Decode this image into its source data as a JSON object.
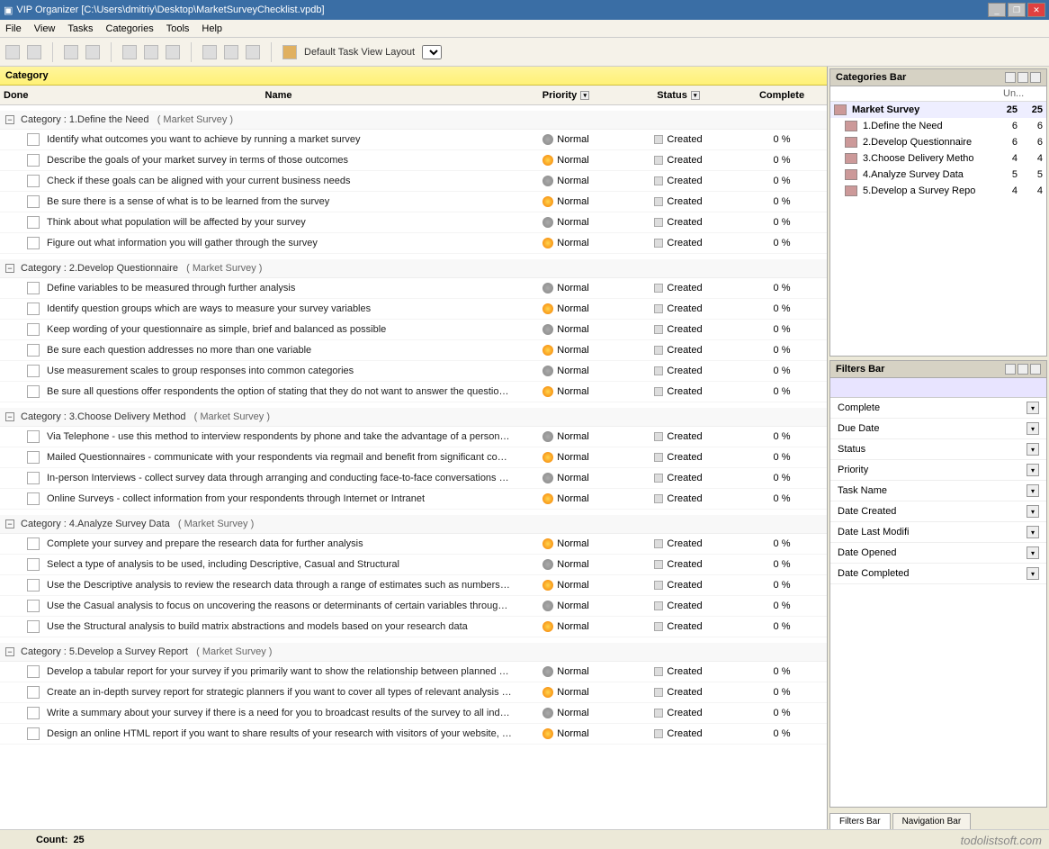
{
  "window": {
    "title": "VIP Organizer [C:\\Users\\dmitriy\\Desktop\\MarketSurveyChecklist.vpdb]"
  },
  "menu": [
    "File",
    "View",
    "Tasks",
    "Categories",
    "Tools",
    "Help"
  ],
  "toolbar": {
    "layoutLabel": "Default Task View Layout"
  },
  "groupHeader": "Category",
  "columns": {
    "done": "Done",
    "name": "Name",
    "priority": "Priority",
    "status": "Status",
    "complete": "Complete"
  },
  "groups": [
    {
      "name": "1.Define the Need",
      "parent": "Market Survey",
      "tasks": [
        {
          "name": "Identify what outcomes you want to achieve by running a market survey",
          "prio": "Normal",
          "pi": "a",
          "status": "Created",
          "comp": "0 %"
        },
        {
          "name": "Describe the goals of your market survey in terms of those outcomes",
          "prio": "Normal",
          "pi": "b",
          "status": "Created",
          "comp": "0 %"
        },
        {
          "name": "Check if these goals can be aligned with your current business needs",
          "prio": "Normal",
          "pi": "a",
          "status": "Created",
          "comp": "0 %"
        },
        {
          "name": "Be sure there is a sense of what is to be learned from the survey",
          "prio": "Normal",
          "pi": "b",
          "status": "Created",
          "comp": "0 %"
        },
        {
          "name": "Think about what population will be affected by your survey",
          "prio": "Normal",
          "pi": "a",
          "status": "Created",
          "comp": "0 %"
        },
        {
          "name": "Figure out what information you will gather through the survey",
          "prio": "Normal",
          "pi": "b",
          "status": "Created",
          "comp": "0 %"
        }
      ]
    },
    {
      "name": "2.Develop Questionnaire",
      "parent": "Market Survey",
      "tasks": [
        {
          "name": "Define variables to be measured through further analysis",
          "prio": "Normal",
          "pi": "a",
          "status": "Created",
          "comp": "0 %"
        },
        {
          "name": "Identify question groups which are ways to measure your survey variables",
          "prio": "Normal",
          "pi": "b",
          "status": "Created",
          "comp": "0 %"
        },
        {
          "name": "Keep wording of your questionnaire as simple, brief and balanced as possible",
          "prio": "Normal",
          "pi": "a",
          "status": "Created",
          "comp": "0 %"
        },
        {
          "name": "Be sure each question addresses no more than one variable",
          "prio": "Normal",
          "pi": "b",
          "status": "Created",
          "comp": "0 %"
        },
        {
          "name": "Use measurement scales to group responses into common categories",
          "prio": "Normal",
          "pi": "a",
          "status": "Created",
          "comp": "0 %"
        },
        {
          "name": "Be sure all questions offer respondents the option of stating that they do not want to answer the question or do not know",
          "prio": "Normal",
          "pi": "b",
          "status": "Created",
          "comp": "0 %"
        }
      ]
    },
    {
      "name": "3.Choose Delivery Method",
      "parent": "Market Survey",
      "tasks": [
        {
          "name": "Via Telephone - use this method to interview respondents by phone and take the advantage of a personal touch and",
          "prio": "Normal",
          "pi": "a",
          "status": "Created",
          "comp": "0 %"
        },
        {
          "name": "Mailed Questionnaires - communicate with your respondents via regmail and benefit from significant cost reductions but be",
          "prio": "Normal",
          "pi": "b",
          "status": "Created",
          "comp": "0 %"
        },
        {
          "name": "In-person Interviews - collect survey data through arranging and conducting face-to-face conversations with your",
          "prio": "Normal",
          "pi": "a",
          "status": "Created",
          "comp": "0 %"
        },
        {
          "name": "Online Surveys - collect information from your respondents through Internet or Intranet",
          "prio": "Normal",
          "pi": "b",
          "status": "Created",
          "comp": "0 %"
        }
      ]
    },
    {
      "name": "4.Analyze Survey Data",
      "parent": "Market Survey",
      "tasks": [
        {
          "name": "Complete your survey and prepare the research data for further analysis",
          "prio": "Normal",
          "pi": "b",
          "status": "Created",
          "comp": "0 %"
        },
        {
          "name": "Select a type of analysis to be used, including Descriptive, Casual and Structural",
          "prio": "Normal",
          "pi": "a",
          "status": "Created",
          "comp": "0 %"
        },
        {
          "name": "Use the Descriptive analysis to review the research data through a range of estimates such as numbers, percentages",
          "prio": "Normal",
          "pi": "b",
          "status": "Created",
          "comp": "0 %"
        },
        {
          "name": "Use the Casual analysis to focus on uncovering the reasons or determinants of certain variables through hypothesis testing",
          "prio": "Normal",
          "pi": "a",
          "status": "Created",
          "comp": "0 %"
        },
        {
          "name": "Use the Structural analysis to build matrix abstractions and models based on your research data",
          "prio": "Normal",
          "pi": "b",
          "status": "Created",
          "comp": "0 %"
        }
      ]
    },
    {
      "name": "5.Develop a Survey Report",
      "parent": "Market Survey",
      "tasks": [
        {
          "name": "Develop a tabular report for your survey if you primarily want to show the relationship between planned research variables",
          "prio": "Normal",
          "pi": "a",
          "status": "Created",
          "comp": "0 %"
        },
        {
          "name": "Create an in-depth survey report for strategic planners if you want to cover all types of relevant analysis performed upon the",
          "prio": "Normal",
          "pi": "b",
          "status": "Created",
          "comp": "0 %"
        },
        {
          "name": "Write a summary about your survey if there is a need for you to broadcast results of the survey to all individuals in your",
          "prio": "Normal",
          "pi": "a",
          "status": "Created",
          "comp": "0 %"
        },
        {
          "name": "Design an online HTML report if you want to share results of your research with visitors of your website, including your",
          "prio": "Normal",
          "pi": "b",
          "status": "Created",
          "comp": "0 %"
        }
      ]
    }
  ],
  "count": {
    "label": "Count:",
    "value": "25"
  },
  "categoriesBar": {
    "title": "Categories Bar",
    "colUn": "Un...",
    "root": {
      "name": "Market Survey",
      "n1": "25",
      "n2": "25"
    },
    "items": [
      {
        "name": "1.Define the Need",
        "n1": "6",
        "n2": "6"
      },
      {
        "name": "2.Develop Questionnaire",
        "n1": "6",
        "n2": "6"
      },
      {
        "name": "3.Choose Delivery Metho",
        "n1": "4",
        "n2": "4"
      },
      {
        "name": "4.Analyze Survey Data",
        "n1": "5",
        "n2": "5"
      },
      {
        "name": "5.Develop a Survey Repo",
        "n1": "4",
        "n2": "4"
      }
    ]
  },
  "filtersBar": {
    "title": "Filters Bar",
    "fields": [
      "Complete",
      "Due Date",
      "Status",
      "Priority",
      "Task Name",
      "Date Created",
      "Date Last Modifi",
      "Date Opened",
      "Date Completed"
    ]
  },
  "tabs": {
    "filters": "Filters Bar",
    "nav": "Navigation Bar"
  },
  "watermark": "todolistsoft.com"
}
